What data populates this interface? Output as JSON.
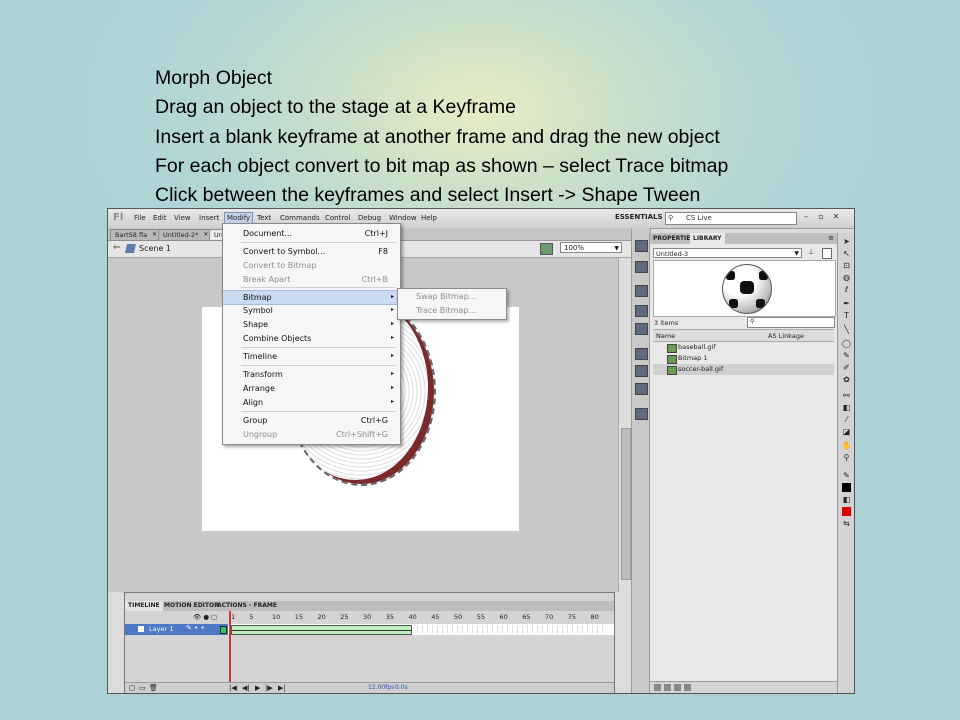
{
  "slide": {
    "lines": [
      "Morph Object",
      "Drag an object to the stage at a Keyframe",
      "Insert a blank keyframe at another frame and drag the new object",
      "For each object convert to bit map as shown – select Trace bitmap",
      "Click between the keyframes and select Insert -> Shape Tween"
    ]
  },
  "app": {
    "logo": "Fl",
    "menu": [
      "File",
      "Edit",
      "View",
      "Insert",
      "Modify",
      "Text",
      "Commands",
      "Control",
      "Debug",
      "Window",
      "Help"
    ],
    "workspace": "ESSENTIALS ▾",
    "search_label": "CS Live",
    "doc_tabs": [
      "BartS8.fla",
      "Untitled-2*",
      "Unt"
    ],
    "scene": "Scene 1",
    "zoom": "100%"
  },
  "modify_menu": [
    {
      "label": "Document...",
      "shortcut": "Ctrl+J",
      "disabled": false,
      "sub": false
    },
    {
      "label": "Convert to Symbol...",
      "shortcut": "F8",
      "disabled": false,
      "sub": false
    },
    {
      "label": "Convert to Bitmap",
      "shortcut": "",
      "disabled": true,
      "sub": false
    },
    {
      "label": "Break Apart",
      "shortcut": "Ctrl+B",
      "disabled": true,
      "sub": false
    },
    {
      "label": "Bitmap",
      "shortcut": "",
      "disabled": false,
      "sub": true
    },
    {
      "label": "Symbol",
      "shortcut": "",
      "disabled": false,
      "sub": true
    },
    {
      "label": "Shape",
      "shortcut": "",
      "disabled": false,
      "sub": true
    },
    {
      "label": "Combine Objects",
      "shortcut": "",
      "disabled": false,
      "sub": true
    },
    {
      "label": "Timeline",
      "shortcut": "",
      "disabled": false,
      "sub": true
    },
    {
      "label": "Transform",
      "shortcut": "",
      "disabled": false,
      "sub": true
    },
    {
      "label": "Arrange",
      "shortcut": "",
      "disabled": false,
      "sub": true
    },
    {
      "label": "Align",
      "shortcut": "",
      "disabled": false,
      "sub": true
    },
    {
      "label": "Group",
      "shortcut": "Ctrl+G",
      "disabled": false,
      "sub": false
    },
    {
      "label": "Ungroup",
      "shortcut": "Ctrl+Shift+G",
      "disabled": true,
      "sub": false
    }
  ],
  "bitmap_submenu": [
    "Swap Bitmap...",
    "Trace Bitmap..."
  ],
  "library": {
    "tabs": [
      "PROPERTIES",
      "LIBRARY"
    ],
    "document": "Untitled-3",
    "count": "3 items",
    "col_name": "Name",
    "col_linkage": "AS Linkage",
    "items": [
      "baseball.gif",
      "Bitmap 1",
      "soccer-ball.gif"
    ]
  },
  "timeline": {
    "tabs": [
      "TIMELINE",
      "MOTION EDITOR",
      "ACTIONS - FRAME"
    ],
    "ruler": [
      "1",
      "5",
      "10",
      "15",
      "20",
      "25",
      "30",
      "35",
      "40",
      "45",
      "50",
      "55",
      "60",
      "65",
      "70",
      "75",
      "80"
    ],
    "layer": "Layer 1",
    "fps": "12.00fps",
    "time": "0.0s"
  }
}
